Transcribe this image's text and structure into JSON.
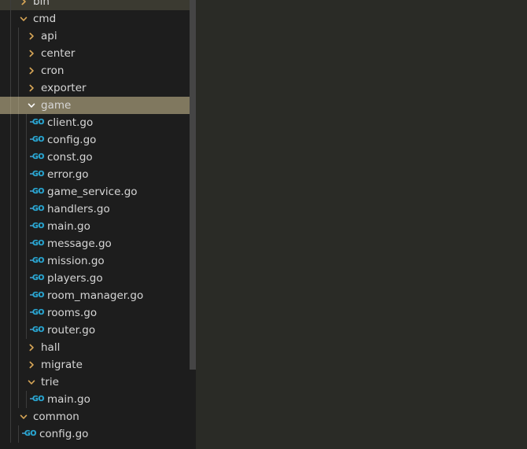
{
  "colors": {
    "sidebar_bg": "#1d1d1d",
    "editor_bg": "#2a2b26",
    "selection_bg": "#80785f",
    "hover_bg": "#3b3a31",
    "chevron": "#d8a657",
    "go_icon": "#29a8d4",
    "text": "#d6d6d6",
    "indent_guide": "#3c3c3c",
    "scrollbar_thumb": "#454545"
  },
  "icons": {
    "chevron_right": "chevron-right-icon",
    "chevron_down": "chevron-down-icon",
    "go_file": "go-file-icon",
    "go_glyph": "GO"
  },
  "scrollbar": {
    "thumb_height": 470,
    "thumb_top": 0
  },
  "tree": {
    "rows": [
      {
        "label": "bin",
        "type": "folder",
        "state": "collapsed",
        "depth": 1,
        "row_state": "hover"
      },
      {
        "label": "cmd",
        "type": "folder",
        "state": "expanded",
        "depth": 1,
        "row_state": "none"
      },
      {
        "label": "api",
        "type": "folder",
        "state": "collapsed",
        "depth": 2,
        "row_state": "none"
      },
      {
        "label": "center",
        "type": "folder",
        "state": "collapsed",
        "depth": 2,
        "row_state": "none"
      },
      {
        "label": "cron",
        "type": "folder",
        "state": "collapsed",
        "depth": 2,
        "row_state": "none"
      },
      {
        "label": "exporter",
        "type": "folder",
        "state": "collapsed",
        "depth": 2,
        "row_state": "none"
      },
      {
        "label": "game",
        "type": "folder",
        "state": "expanded",
        "depth": 2,
        "row_state": "selected"
      },
      {
        "label": "client.go",
        "type": "file",
        "state": "none",
        "depth": 3,
        "row_state": "none"
      },
      {
        "label": "config.go",
        "type": "file",
        "state": "none",
        "depth": 3,
        "row_state": "none"
      },
      {
        "label": "const.go",
        "type": "file",
        "state": "none",
        "depth": 3,
        "row_state": "none"
      },
      {
        "label": "error.go",
        "type": "file",
        "state": "none",
        "depth": 3,
        "row_state": "none"
      },
      {
        "label": "game_service.go",
        "type": "file",
        "state": "none",
        "depth": 3,
        "row_state": "none"
      },
      {
        "label": "handlers.go",
        "type": "file",
        "state": "none",
        "depth": 3,
        "row_state": "none"
      },
      {
        "label": "main.go",
        "type": "file",
        "state": "none",
        "depth": 3,
        "row_state": "none"
      },
      {
        "label": "message.go",
        "type": "file",
        "state": "none",
        "depth": 3,
        "row_state": "none"
      },
      {
        "label": "mission.go",
        "type": "file",
        "state": "none",
        "depth": 3,
        "row_state": "none"
      },
      {
        "label": "players.go",
        "type": "file",
        "state": "none",
        "depth": 3,
        "row_state": "none"
      },
      {
        "label": "room_manager.go",
        "type": "file",
        "state": "none",
        "depth": 3,
        "row_state": "none"
      },
      {
        "label": "rooms.go",
        "type": "file",
        "state": "none",
        "depth": 3,
        "row_state": "none"
      },
      {
        "label": "router.go",
        "type": "file",
        "state": "none",
        "depth": 3,
        "row_state": "none"
      },
      {
        "label": "hall",
        "type": "folder",
        "state": "collapsed",
        "depth": 2,
        "row_state": "none"
      },
      {
        "label": "migrate",
        "type": "folder",
        "state": "collapsed",
        "depth": 2,
        "row_state": "none"
      },
      {
        "label": "trie",
        "type": "folder",
        "state": "expanded",
        "depth": 2,
        "row_state": "none"
      },
      {
        "label": "main.go",
        "type": "file",
        "state": "none",
        "depth": 3,
        "row_state": "none"
      },
      {
        "label": "common",
        "type": "folder",
        "state": "expanded",
        "depth": 1,
        "row_state": "none"
      },
      {
        "label": "config.go",
        "type": "file",
        "state": "none",
        "depth": 2,
        "row_state": "none"
      }
    ]
  }
}
